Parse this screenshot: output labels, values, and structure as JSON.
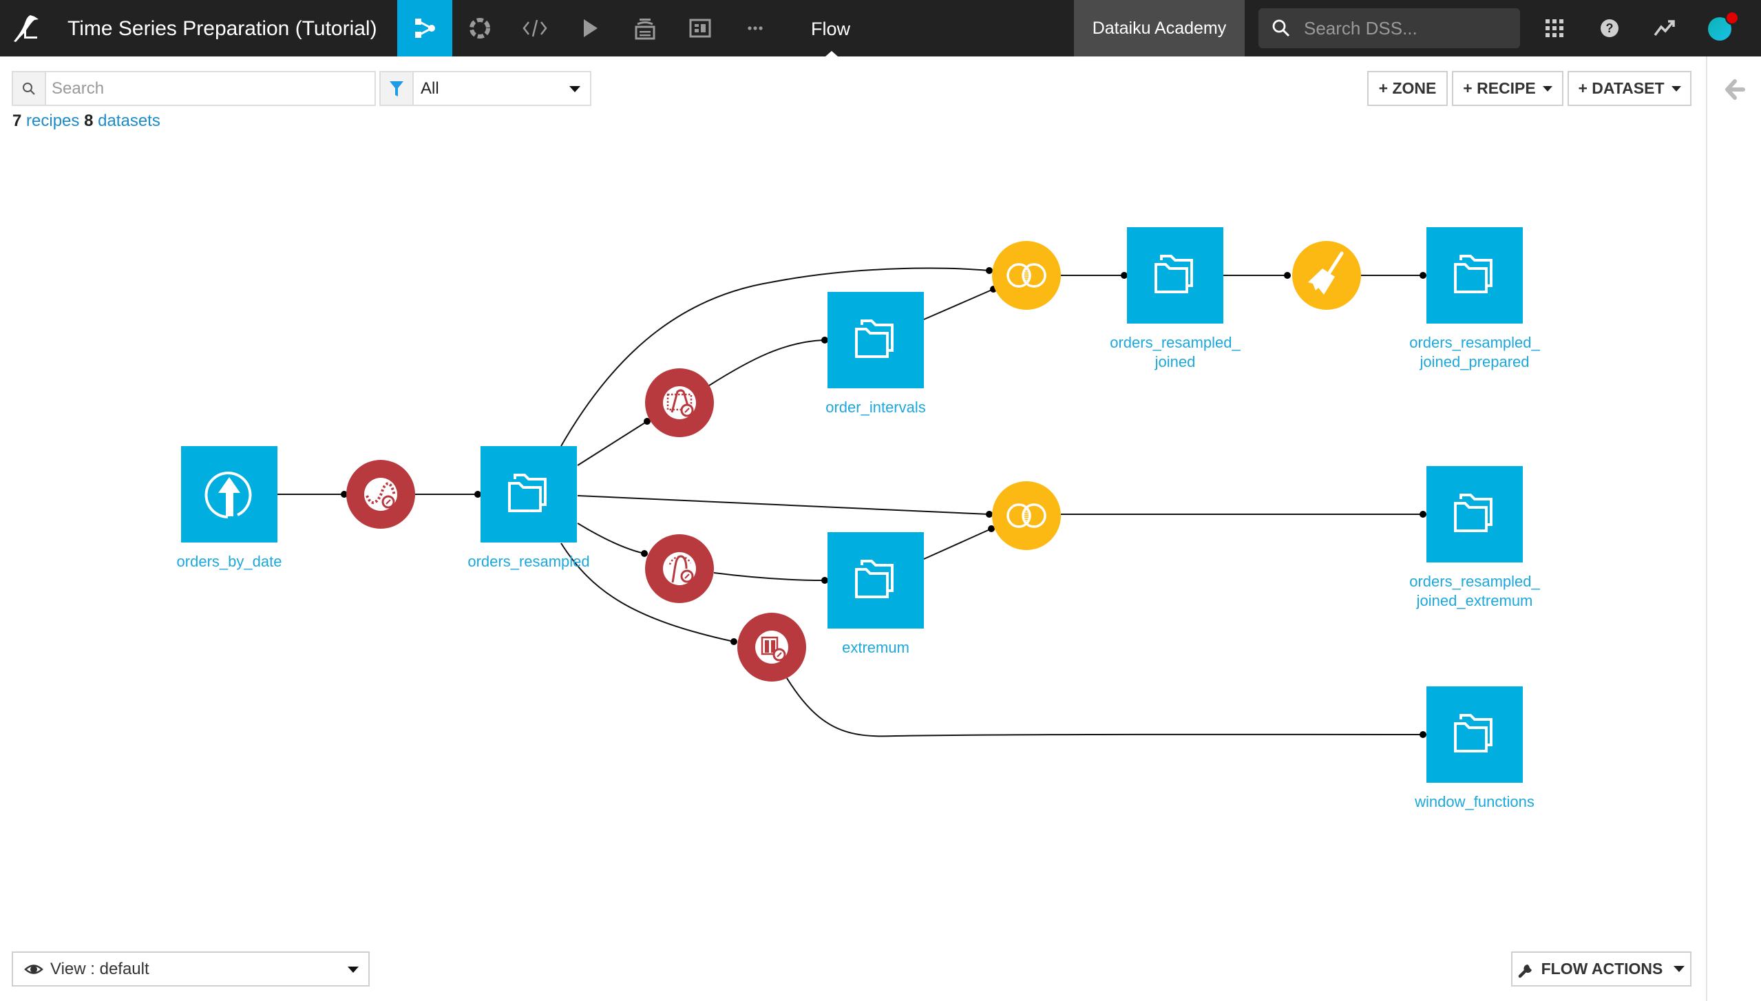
{
  "header": {
    "project_title": "Time Series Preparation (Tutorial)",
    "current_section": "Flow",
    "org_badge": "Dataiku Academy",
    "search_placeholder": "Search DSS...",
    "nav_icons": [
      "flow-icon",
      "lab-icon",
      "code-icon",
      "jobs-run-icon",
      "datasets-stack-icon",
      "dashboard-icon",
      "more-icon"
    ],
    "right_icons": [
      "apps-grid-icon",
      "help-icon",
      "activity-trend-icon",
      "user-avatar"
    ],
    "accent_color": "#00a8de"
  },
  "toolbar": {
    "search_placeholder": "Search",
    "filter_value": "All",
    "counts": {
      "recipes_num": "7",
      "recipes_label": "recipes",
      "datasets_num": "8",
      "datasets_label": "datasets"
    },
    "zone_button": "+ ZONE",
    "recipe_button": "+ RECIPE",
    "dataset_button": "+ DATASET"
  },
  "flow": {
    "colors": {
      "dataset": "#00aee0",
      "visual_recipe": "#fdb913",
      "plugin_recipe": "#b8393e",
      "edge": "#111111"
    },
    "datasets": [
      {
        "id": "orders_by_date",
        "label": "orders_by_date",
        "kind": "uploaded"
      },
      {
        "id": "orders_resampled",
        "label": "orders_resampled",
        "kind": "filesystem"
      },
      {
        "id": "order_intervals",
        "label": "order_intervals",
        "kind": "filesystem"
      },
      {
        "id": "extremum",
        "label": "extremum",
        "kind": "filesystem"
      },
      {
        "id": "orders_resampled_joined",
        "label": "orders_resampled_\njoined",
        "kind": "filesystem"
      },
      {
        "id": "orders_resampled_joined_prepared",
        "label": "orders_resampled_\njoined_prepared",
        "kind": "filesystem"
      },
      {
        "id": "orders_resampled_joined_extremum",
        "label": "orders_resampled_\njoined_extremum",
        "kind": "filesystem"
      },
      {
        "id": "window_functions",
        "label": "window_functions",
        "kind": "filesystem"
      }
    ],
    "recipes": [
      {
        "id": "resample",
        "type": "timeseries-resampling",
        "icon": "resampling-icon"
      },
      {
        "id": "intervals",
        "type": "timeseries-interval-extraction",
        "icon": "interval-extraction-icon"
      },
      {
        "id": "extrema",
        "type": "timeseries-extrema-extraction",
        "icon": "extrema-extraction-icon"
      },
      {
        "id": "windowing",
        "type": "timeseries-windowing",
        "icon": "windowing-icon"
      },
      {
        "id": "join1",
        "type": "join",
        "icon": "join-icon"
      },
      {
        "id": "join2",
        "type": "join",
        "icon": "join-icon"
      },
      {
        "id": "prepare",
        "type": "prepare",
        "icon": "prepare-broom-icon"
      }
    ],
    "edges": [
      [
        "orders_by_date",
        "resample"
      ],
      [
        "resample",
        "orders_resampled"
      ],
      [
        "orders_resampled",
        "intervals"
      ],
      [
        "intervals",
        "order_intervals"
      ],
      [
        "orders_resampled",
        "join1"
      ],
      [
        "order_intervals",
        "join1"
      ],
      [
        "join1",
        "orders_resampled_joined"
      ],
      [
        "orders_resampled_joined",
        "prepare"
      ],
      [
        "prepare",
        "orders_resampled_joined_prepared"
      ],
      [
        "orders_resampled",
        "extrema"
      ],
      [
        "extrema",
        "extremum"
      ],
      [
        "orders_resampled",
        "join2"
      ],
      [
        "extremum",
        "join2"
      ],
      [
        "join2",
        "orders_resampled_joined_extremum"
      ],
      [
        "orders_resampled",
        "windowing"
      ],
      [
        "windowing",
        "window_functions"
      ]
    ]
  },
  "footer": {
    "view_label": "View : default",
    "flow_actions_label": "FLOW ACTIONS"
  }
}
